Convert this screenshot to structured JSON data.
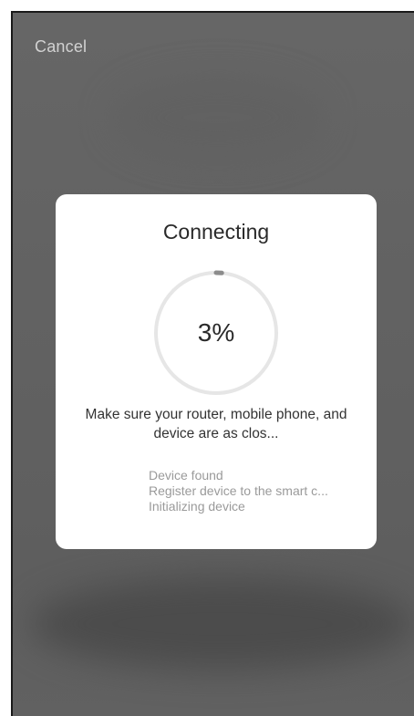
{
  "header": {
    "cancel_label": "Cancel"
  },
  "dialog": {
    "title": "Connecting",
    "progress": {
      "percent": 3,
      "label": "3%"
    },
    "hint": "Make sure your router, mobile phone, and device are as clos...",
    "steps": [
      {
        "label": "Device found"
      },
      {
        "label": "Register device to the smart c..."
      },
      {
        "label": "Initializing device"
      }
    ]
  },
  "colors": {
    "overlay": "#636363",
    "ring_track": "#e6e6e6",
    "ring_progress": "#8c8c8c",
    "dialog_background": "#ffffff"
  }
}
